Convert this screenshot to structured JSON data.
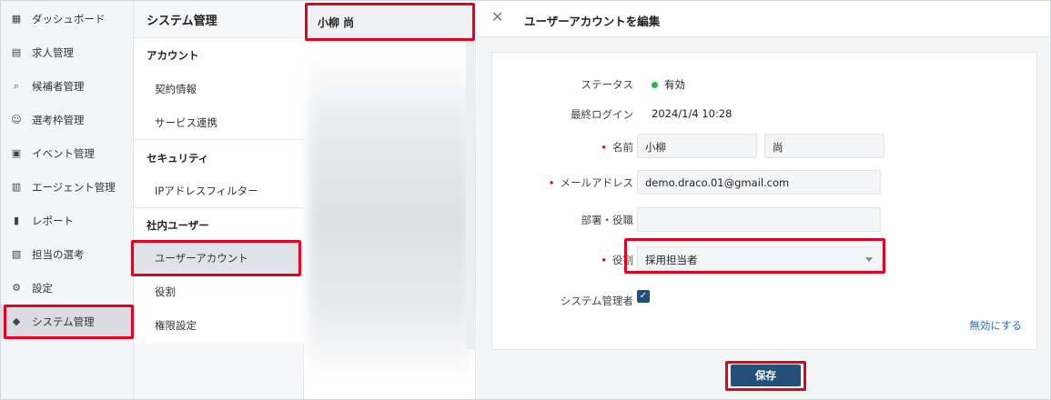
{
  "nav": {
    "items": [
      {
        "label": "ダッシュボード",
        "icon": "dashboard-icon",
        "glyph": "▦"
      },
      {
        "label": "求人管理",
        "icon": "jobs-icon",
        "glyph": "▤"
      },
      {
        "label": "候補者管理",
        "icon": "candidate-search-icon",
        "glyph": "⌕"
      },
      {
        "label": "選考枠管理",
        "icon": "selection-slot-icon",
        "glyph": "☺"
      },
      {
        "label": "イベント管理",
        "icon": "calendar-icon",
        "glyph": "▣"
      },
      {
        "label": "エージェント管理",
        "icon": "agent-icon",
        "glyph": "▥"
      },
      {
        "label": "レポート",
        "icon": "report-chart-icon",
        "glyph": "▮"
      },
      {
        "label": "担当の選考",
        "icon": "assigned-selection-icon",
        "glyph": "▧"
      },
      {
        "label": "設定",
        "icon": "gear-icon",
        "glyph": "⚙"
      },
      {
        "label": "システム管理",
        "icon": "shield-icon",
        "glyph": "◆"
      }
    ]
  },
  "menu": {
    "title": "システム管理",
    "sections": [
      {
        "heading": "アカウント",
        "items": [
          "契約情報",
          "サービス連携"
        ]
      },
      {
        "heading": "セキュリティ",
        "items": [
          "IPアドレスフィルター"
        ]
      },
      {
        "heading": "社内ユーザー",
        "items": [
          "ユーザーアカウント",
          "役割",
          "権限設定"
        ]
      }
    ]
  },
  "users": {
    "selected": "小柳 尚"
  },
  "detail": {
    "title": "ユーザーアカウントを編集",
    "fields": {
      "status_label": "ステータス",
      "status_value": "有効",
      "last_login_label": "最終ログイン",
      "last_login_value": "2024/1/4 10:28",
      "name_label": "名前",
      "last_name": "小柳",
      "first_name": "尚",
      "email_label": "メールアドレス",
      "email": "demo.draco.01@gmail.com",
      "dept_label": "部署・役職",
      "dept_value": "",
      "role_label": "役割",
      "role_value": "採用担当者",
      "sysadmin_label": "システム管理者"
    },
    "disable_link": "無効にする",
    "save_label": "保存"
  },
  "colors": {
    "highlight": "#e5001e",
    "primary": "#22507a",
    "link": "#2a6fb0",
    "status_active": "#2fb24a",
    "required": "#d0021b"
  }
}
